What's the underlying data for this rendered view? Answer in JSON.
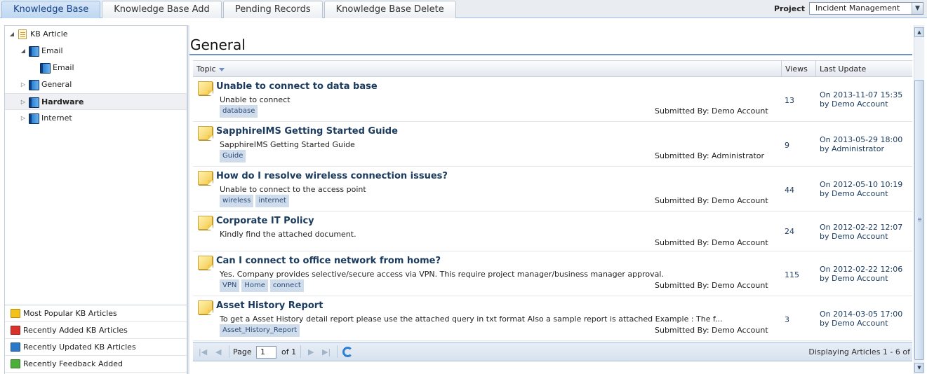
{
  "tabs": [
    {
      "label": "Knowledge Base",
      "active": true
    },
    {
      "label": "Knowledge Base Add",
      "active": false
    },
    {
      "label": "Pending Records",
      "active": false
    },
    {
      "label": "Knowledge Base Delete",
      "active": false
    }
  ],
  "project": {
    "label": "Project",
    "selected": "Incident Management"
  },
  "tree": {
    "root": "KB Article",
    "items": [
      {
        "label": "Email",
        "expanded": true
      },
      {
        "label": "Email"
      },
      {
        "label": "General"
      },
      {
        "label": "Hardware",
        "selected": true
      },
      {
        "label": "Internet"
      }
    ]
  },
  "quick_links": [
    {
      "label": "Most Popular KB Articles",
      "color": "#f2c11c"
    },
    {
      "label": "Recently Added KB Articles",
      "color": "#d9312b"
    },
    {
      "label": "Recently Updated KB Articles",
      "color": "#2a78c8"
    },
    {
      "label": "Recently Feedback Added",
      "color": "#4caf3a"
    }
  ],
  "main": {
    "title": "General",
    "columns": {
      "topic": "Topic",
      "views": "Views",
      "last_update": "Last Update"
    }
  },
  "articles": [
    {
      "title": "Unable to connect to data base",
      "desc": "Unable to connect",
      "tags": [
        "database"
      ],
      "submitted": "Submitted By: Demo Account",
      "views": "13",
      "date": "On 2013-11-07 15:35",
      "by": "by Demo Account"
    },
    {
      "title": "SapphireIMS Getting Started Guide",
      "desc": "SapphireIMS Getting Started Guide",
      "tags": [
        "Guide"
      ],
      "submitted": "Submitted By: Administrator",
      "views": "9",
      "date": "On 2013-05-29 18:00",
      "by": "by Administrator"
    },
    {
      "title": "How do I resolve wireless connection issues?",
      "desc": "Unable to connect to the access point",
      "tags": [
        "wireless",
        "internet"
      ],
      "submitted": "Submitted By: Demo Account",
      "views": "44",
      "date": "On 2012-05-10 10:19",
      "by": "by Demo Account"
    },
    {
      "title": "Corporate IT Policy",
      "desc": "Kindly find the attached document.",
      "tags": [],
      "submitted": "Submitted By: Demo Account",
      "views": "24",
      "date": "On 2012-02-22 12:07",
      "by": "by Demo Account"
    },
    {
      "title": "Can I connect to office network from home?",
      "desc": "Yes. Company provides selective/secure access via VPN. This require project manager/business manager approval.",
      "tags": [
        "VPN",
        "Home",
        "connect"
      ],
      "submitted": "Submitted By: Demo Account",
      "views": "115",
      "date": "On 2012-02-22 12:06",
      "by": "by Demo Account"
    },
    {
      "title": "Asset History Report",
      "desc": "To get a Asset History detail report please use the attached query in txt format Also a sample report is attached Example : The f...",
      "tags": [
        "Asset_History_Report"
      ],
      "submitted": "Submitted By: Demo Account",
      "views": "3",
      "date": "On 2014-03-05 17:00",
      "by": "by Demo Account"
    }
  ],
  "pager": {
    "page_label": "Page",
    "page_value": "1",
    "of_label": "of 1",
    "display": "Displaying Articles 1 - 6 of"
  }
}
